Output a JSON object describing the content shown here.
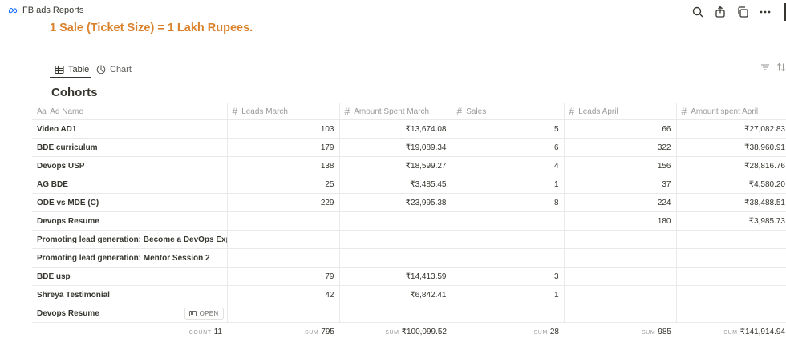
{
  "breadcrumb": {
    "title": "FB ads Reports"
  },
  "headline": "1 Sale (Ticket Size) = 1 Lakh Rupees.",
  "views": {
    "table_label": "Table",
    "chart_label": "Chart"
  },
  "database_title": "Cohorts",
  "columns": [
    "Ad Name",
    "Leads March",
    "Amount Spent March",
    "Sales",
    "Leads April",
    "Amount spent April"
  ],
  "rows": [
    [
      "Video AD1",
      "103",
      "₹13,674.08",
      "5",
      "66",
      "₹27,082.83"
    ],
    [
      "BDE curriculum",
      "179",
      "₹19,089.34",
      "6",
      "322",
      "₹38,960.91"
    ],
    [
      "Devops USP",
      "138",
      "₹18,599.27",
      "4",
      "156",
      "₹28,816.76"
    ],
    [
      "AG BDE",
      "25",
      "₹3,485.45",
      "1",
      "37",
      "₹4,580.20"
    ],
    [
      "ODE vs MDE (C)",
      "229",
      "₹23,995.38",
      "8",
      "224",
      "₹38,488.51"
    ],
    [
      "Devops Resume",
      "",
      "",
      "",
      "180",
      "₹3,985.73"
    ],
    [
      "Promoting lead generation: Become a DevOps Expert",
      "",
      "",
      "",
      "",
      ""
    ],
    [
      "Promoting lead generation: Mentor Session 2",
      "",
      "",
      "",
      "",
      ""
    ],
    [
      "BDE usp",
      "79",
      "₹14,413.59",
      "3",
      "",
      ""
    ],
    [
      "Shreya Testimonial",
      "42",
      "₹6,842.41",
      "1",
      "",
      ""
    ],
    [
      "Devops Resume",
      "",
      "",
      "",
      "",
      ""
    ]
  ],
  "open_button": "OPEN",
  "aggregates": [
    {
      "label": "COUNT",
      "value": "11"
    },
    {
      "label": "SUM",
      "value": "795"
    },
    {
      "label": "SUM",
      "value": "₹100,099.52"
    },
    {
      "label": "SUM",
      "value": "28"
    },
    {
      "label": "SUM",
      "value": "985"
    },
    {
      "label": "SUM",
      "value": "₹141,914.94"
    }
  ],
  "icons": {
    "meta": "meta-logo-icon",
    "search": "search-icon",
    "share": "share-icon",
    "duplicate": "duplicate-icon",
    "more": "more-icon",
    "table": "table-icon",
    "chart": "chart-icon",
    "filter": "filter-icon",
    "sort": "sort-icon",
    "text_prop": "text-property-icon",
    "number_prop": "number-property-icon"
  },
  "colors": {
    "headline": "#d9822b",
    "text": "#37352f",
    "muted": "#9b9a97",
    "border": "#e9e9e7"
  }
}
